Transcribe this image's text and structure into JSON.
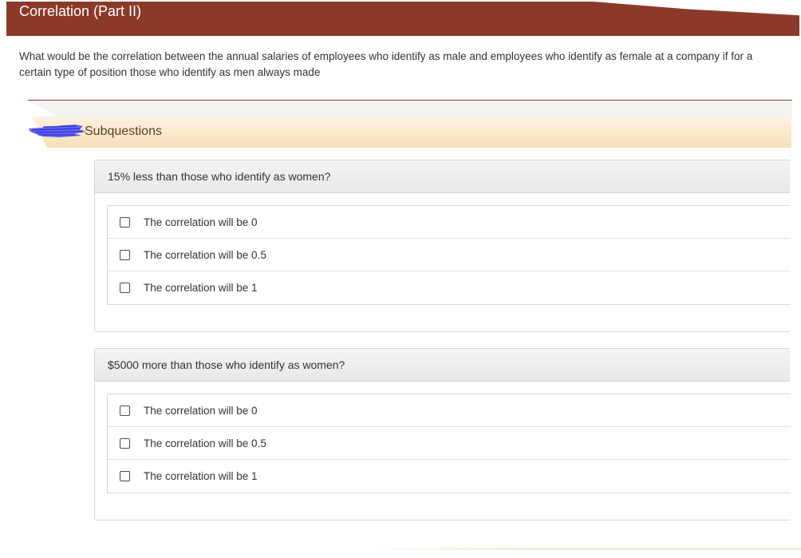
{
  "header": {
    "title": "Correlation (Part II)"
  },
  "question": {
    "text": "What would be the correlation between the annual salaries of employees who identify as male and employees who identify as female at a company if for a certain type of position those who identify as men always made"
  },
  "subquestions": {
    "label": "Subquestions",
    "icon": "redacted-scribble-icon",
    "items": [
      {
        "prompt": "15% less than those who identify as women?",
        "options": [
          {
            "label": "The correlation will be 0",
            "checked": false
          },
          {
            "label": "The correlation will be 0.5",
            "checked": false
          },
          {
            "label": "The correlation will be 1",
            "checked": false
          }
        ]
      },
      {
        "prompt": "$5000 more than those who identify as women?",
        "options": [
          {
            "label": "The correlation will be 0",
            "checked": false
          },
          {
            "label": "The correlation will be 0.5",
            "checked": false
          },
          {
            "label": "The correlation will be 1",
            "checked": false
          }
        ]
      }
    ]
  },
  "colors": {
    "header_bg": "#8b3a2a",
    "subquestions_bar": "#f7e0b8",
    "card_header": "#e8e8e8"
  }
}
